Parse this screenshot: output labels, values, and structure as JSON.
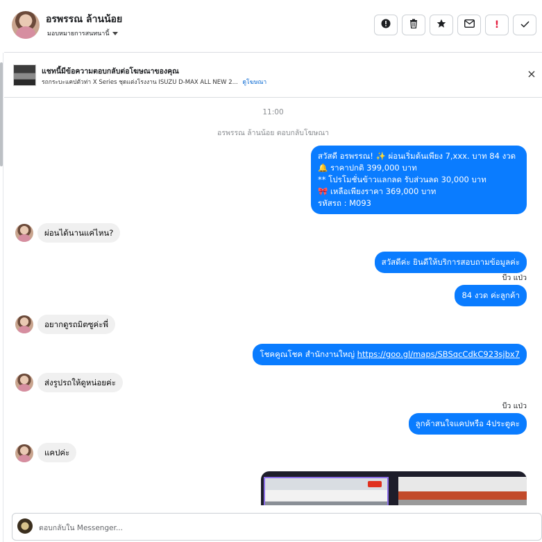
{
  "header": {
    "contact_name": "อรพรรณ ล้านน้อย",
    "assign_label": "มอบหมายการสนทนานี้",
    "actions": [
      {
        "icon": "alert-circle-icon",
        "glyph": "!"
      },
      {
        "icon": "trash-icon",
        "glyph": "🗑"
      },
      {
        "icon": "star-icon",
        "glyph": "★"
      },
      {
        "icon": "mail-icon",
        "glyph": "✉"
      },
      {
        "icon": "exclamation-icon",
        "glyph": "!"
      },
      {
        "icon": "check-icon",
        "glyph": "✓"
      }
    ]
  },
  "ad_banner": {
    "title": "แชทนี้มีข้อความตอบกลับต่อโฆษณาของคุณ",
    "subtitle": "รถกระบะแคปตัวท่า X Series ชุดแต่งโรงงาน ISUZU D-MAX ALL NEW 2...",
    "link": "ดูโฆษณา",
    "close": "×"
  },
  "conversation": {
    "timestamp": "11:00",
    "reply_note": "อรพรรณ ล้านน้อย ตอบกลับโฆษณา",
    "msg1": {
      "line1": "สวัสดี อรพรรณ! ✨  ผ่อนเริ่มต้นเพียง 7,xxx. บาท 84 งวด",
      "line2": "🔔 ราคาปกติ 399,000 บาท",
      "line3": "** โปรโมชั่นข้าวแลกลด รับส่วนลด 30,000 บาท",
      "line4": "🎀  เหลือเพียงราคา 369,000 บาท",
      "line5": " รหัสรถ : M093"
    },
    "in1": "ผ่อนได้นานแค่ไหน?",
    "out2": "สวัสดีค่ะ  ยินดีให้บริการสอบถามข้อมูลค่ะ",
    "seen1": "บีว แป่ว",
    "out3": "84 งวด  ค่ะลูกค้า",
    "in2": "อยากดูรถมิตซูค่ะพี่",
    "out4_prefix": "โชคคูณโชค สำนักงานใหญ่ ",
    "out4_link": "https://goo.gl/maps/SBSqcCdkC923sjbx7",
    "in3": "ส่งรูปรถให้ดูหน่อยค่ะ",
    "seen2": "บีว แป่ว",
    "out5": "ลูกค้าสนใจแคปหรือ  4ประตูคะ",
    "in4": "แคปค่ะ"
  },
  "composer": {
    "placeholder": "ตอบกลับใน Messenger..."
  },
  "colors": {
    "outgoing": "#0a7cff",
    "incoming": "#f0f0f0",
    "link": "#0064d1",
    "danger": "#e41e3f"
  }
}
